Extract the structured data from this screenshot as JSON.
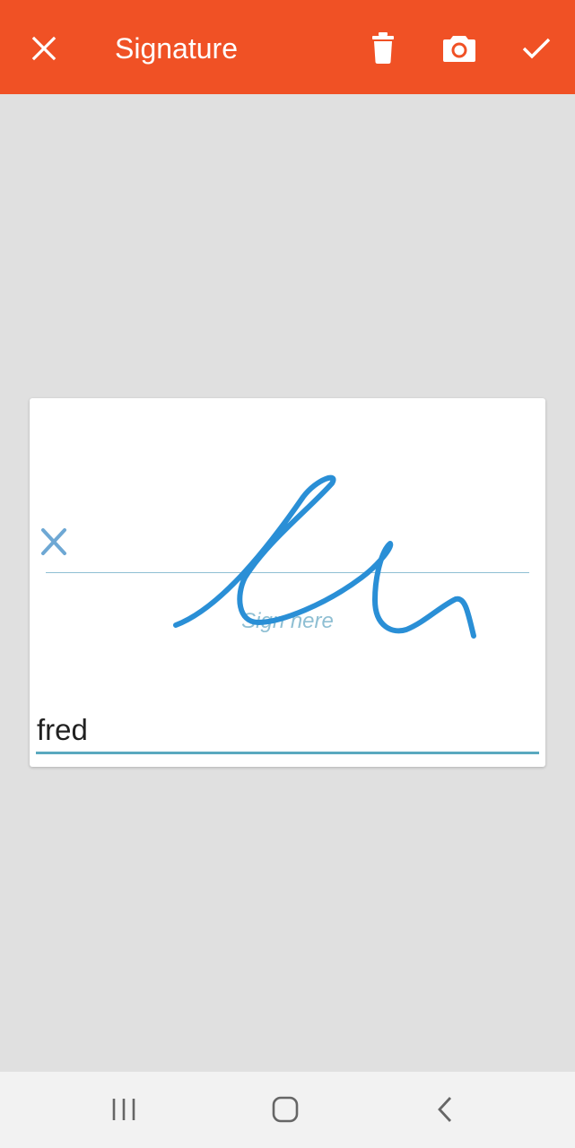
{
  "toolbar": {
    "title": "Signature",
    "background": "#f05125",
    "icons": {
      "close": "close-icon",
      "delete": "trash-icon",
      "camera": "camera-icon",
      "confirm": "check-icon"
    }
  },
  "signature_pad": {
    "hint": "Sign here",
    "marker": "x-mark-icon",
    "stroke_color": "#2a8fd6",
    "name_value": "fred"
  },
  "navbar": {
    "icons": {
      "recents": "recents-icon",
      "home": "home-icon",
      "back": "back-icon"
    }
  }
}
